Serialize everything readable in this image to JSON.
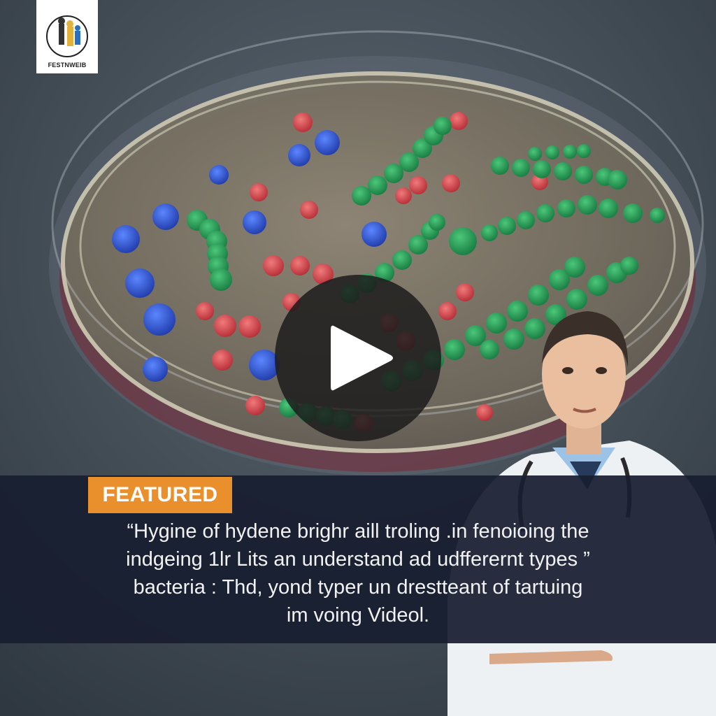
{
  "brand": {
    "name": "FESTNWEIB",
    "logo_icon": "scientists-emblem-icon"
  },
  "video": {
    "play_icon": "play-icon"
  },
  "background": {
    "scene": "petri-dish-bacteria",
    "presenter": "doctor-presenter"
  },
  "banner": {
    "badge": "FEATURED",
    "caption_lines": [
      "“Hygine of hydene brighr aill troling .in fenoioing the",
      "indgeing 1lr Lits an understand ad udfferernt types ”",
      "bacteria : Thd, yond typer un drestteant of tartuing",
      "im voing Videol."
    ]
  },
  "colors": {
    "badge": "#e98f2b",
    "banner": "#181e30",
    "bacteria_green": "#2fa35a",
    "bacteria_blue": "#2a55c8",
    "bacteria_red": "#d84a4a"
  }
}
